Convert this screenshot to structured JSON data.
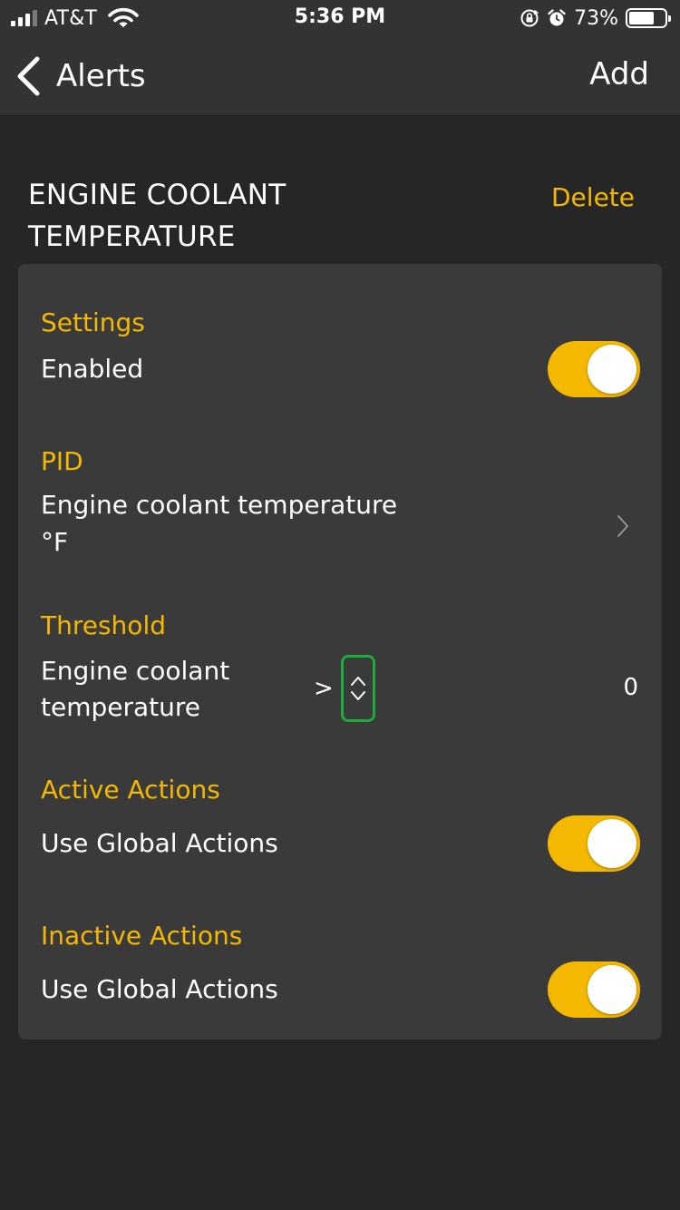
{
  "status_bar": {
    "carrier": "AT&T",
    "time": "5:36 PM",
    "battery": "73%",
    "battery_level": 0.73,
    "icons": [
      "signal-icon",
      "wifi-icon",
      "orientation-lock-icon",
      "alarm-icon",
      "battery-icon"
    ]
  },
  "nav": {
    "back_label": "Alerts",
    "add_label": "Add"
  },
  "alert": {
    "title_line1": "ENGINE COOLANT",
    "title_line2": "TEMPERATURE",
    "delete_label": "Delete"
  },
  "settings": {
    "label": "Settings",
    "enabled_label": "Enabled",
    "enabled": true
  },
  "pid": {
    "label": "PID",
    "name": "Engine coolant temperature",
    "unit": "°F"
  },
  "threshold": {
    "label": "Threshold",
    "name_line1": "Engine coolant",
    "name_line2": "temperature",
    "operator": ">",
    "value": "0"
  },
  "active_actions": {
    "label": "Active Actions",
    "option_label": "Use Global Actions",
    "enabled": true
  },
  "inactive_actions": {
    "label": "Inactive Actions",
    "option_label": "Use Global Actions",
    "enabled": true
  },
  "colors": {
    "accent": "#f5b800",
    "background": "#262626",
    "card": "#3a3a3a",
    "bar": "#333333",
    "highlight": "#1faa3d"
  }
}
